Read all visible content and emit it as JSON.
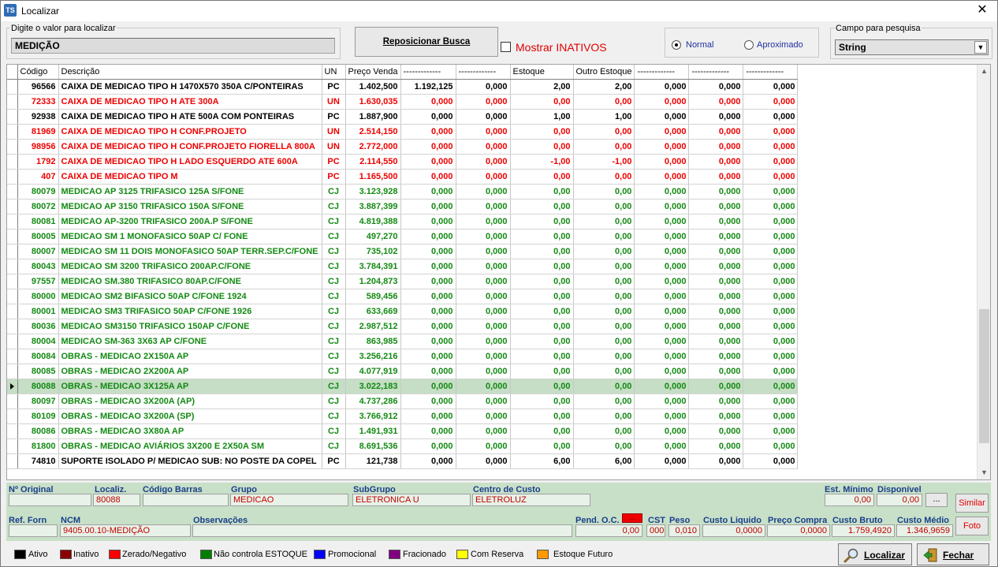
{
  "window": {
    "title": "Localizar",
    "icon_text": "TS"
  },
  "search": {
    "label": "Digite o valor para localizar",
    "value": "MEDIÇÃO",
    "reposition_button": "Reposicionar Busca",
    "show_inactive_label": "Mostrar INATIVOS",
    "show_inactive_checked": false,
    "mode_normal": "Normal",
    "mode_approx": "Aproximado",
    "mode_selected": "Normal",
    "field_label": "Campo para pesquisa",
    "field_value": "String"
  },
  "grid": {
    "columns": [
      "Código",
      "Descrição",
      "UN",
      "Preço Venda",
      "-------------",
      "-------------",
      "Estoque",
      "Outro Estoque",
      "-------------",
      "-------------",
      "-------------"
    ],
    "rows": [
      {
        "status": "black",
        "cells": [
          "96566",
          "CAIXA DE MEDICAO TIPO H 1470X570 350A C/PONTEIRAS",
          "PC",
          "1.402,500",
          "1.192,125",
          "0,000",
          "2,00",
          "2,00",
          "0,000",
          "0,000",
          "0,000"
        ]
      },
      {
        "status": "red",
        "cells": [
          "72333",
          "CAIXA DE MEDICAO TIPO H ATE 300A",
          "UN",
          "1.630,035",
          "0,000",
          "0,000",
          "0,00",
          "0,00",
          "0,000",
          "0,000",
          "0,000"
        ]
      },
      {
        "status": "black",
        "cells": [
          "92938",
          "CAIXA DE MEDICAO TIPO H ATE 500A COM PONTEIRAS",
          "PC",
          "1.887,900",
          "0,000",
          "0,000",
          "1,00",
          "1,00",
          "0,000",
          "0,000",
          "0,000"
        ]
      },
      {
        "status": "red",
        "cells": [
          "81969",
          "CAIXA DE MEDICAO TIPO H CONF.PROJETO",
          "UN",
          "2.514,150",
          "0,000",
          "0,000",
          "0,00",
          "0,00",
          "0,000",
          "0,000",
          "0,000"
        ]
      },
      {
        "status": "red",
        "cells": [
          "98956",
          "CAIXA DE MEDICAO TIPO H CONF.PROJETO FIORELLA 800A",
          "UN",
          "2.772,000",
          "0,000",
          "0,000",
          "0,00",
          "0,00",
          "0,000",
          "0,000",
          "0,000"
        ]
      },
      {
        "status": "red",
        "cells": [
          "1792",
          "CAIXA DE MEDICAO TIPO H LADO ESQUERDO   ATE 600A",
          "PC",
          "2.114,550",
          "0,000",
          "0,000",
          "-1,00",
          "-1,00",
          "0,000",
          "0,000",
          "0,000"
        ]
      },
      {
        "status": "red",
        "cells": [
          "407",
          "CAIXA DE MEDICAO TIPO M",
          "PC",
          "1.165,500",
          "0,000",
          "0,000",
          "0,00",
          "0,00",
          "0,000",
          "0,000",
          "0,000"
        ]
      },
      {
        "status": "green",
        "cells": [
          "80079",
          "MEDICAO AP 3125 TRIFASICO 125A S/FONE",
          "CJ",
          "3.123,928",
          "0,000",
          "0,000",
          "0,00",
          "0,00",
          "0,000",
          "0,000",
          "0,000"
        ]
      },
      {
        "status": "green",
        "cells": [
          "80072",
          "MEDICAO AP 3150 TRIFASICO 150A S/FONE",
          "CJ",
          "3.887,399",
          "0,000",
          "0,000",
          "0,00",
          "0,00",
          "0,000",
          "0,000",
          "0,000"
        ]
      },
      {
        "status": "green",
        "cells": [
          "80081",
          "MEDICAO AP-3200 TRIFASICO 200A.P S/FONE",
          "CJ",
          "4.819,388",
          "0,000",
          "0,000",
          "0,00",
          "0,00",
          "0,000",
          "0,000",
          "0,000"
        ]
      },
      {
        "status": "green",
        "cells": [
          "80005",
          "MEDICAO SM 1 MONOFASICO 50AP C/ FONE",
          "CJ",
          "497,270",
          "0,000",
          "0,000",
          "0,00",
          "0,00",
          "0,000",
          "0,000",
          "0,000"
        ]
      },
      {
        "status": "green",
        "cells": [
          "80007",
          "MEDICAO SM 11 DOIS MONOFASICO 50AP TERR.SEP.C/FONE",
          "CJ",
          "735,102",
          "0,000",
          "0,000",
          "0,00",
          "0,00",
          "0,000",
          "0,000",
          "0,000"
        ]
      },
      {
        "status": "green",
        "cells": [
          "80043",
          "MEDICAO SM 3200 TRIFASICO 200AP.C/FONE",
          "CJ",
          "3.784,391",
          "0,000",
          "0,000",
          "0,00",
          "0,00",
          "0,000",
          "0,000",
          "0,000"
        ]
      },
      {
        "status": "green",
        "cells": [
          "97557",
          "MEDICAO SM.380 TRIFASICO 80AP.C/FONE",
          "CJ",
          "1.204,873",
          "0,000",
          "0,000",
          "0,00",
          "0,00",
          "0,000",
          "0,000",
          "0,000"
        ]
      },
      {
        "status": "green",
        "cells": [
          "80000",
          "MEDICAO SM2 BIFASICO 50AP C/FONE 1924",
          "CJ",
          "589,456",
          "0,000",
          "0,000",
          "0,00",
          "0,00",
          "0,000",
          "0,000",
          "0,000"
        ]
      },
      {
        "status": "green",
        "cells": [
          "80001",
          "MEDICAO SM3 TRIFASICO 50AP C/FONE 1926",
          "CJ",
          "633,669",
          "0,000",
          "0,000",
          "0,00",
          "0,00",
          "0,000",
          "0,000",
          "0,000"
        ]
      },
      {
        "status": "green",
        "cells": [
          "80036",
          "MEDICAO SM3150 TRIFASICO 150AP C/FONE",
          "CJ",
          "2.987,512",
          "0,000",
          "0,000",
          "0,00",
          "0,00",
          "0,000",
          "0,000",
          "0,000"
        ]
      },
      {
        "status": "green",
        "cells": [
          "80004",
          "MEDICAO SM-363 3X63 AP C/FONE",
          "CJ",
          "863,985",
          "0,000",
          "0,000",
          "0,00",
          "0,00",
          "0,000",
          "0,000",
          "0,000"
        ]
      },
      {
        "status": "green",
        "cells": [
          "80084",
          "OBRAS - MEDICAO 2X150A AP",
          "CJ",
          "3.256,216",
          "0,000",
          "0,000",
          "0,00",
          "0,00",
          "0,000",
          "0,000",
          "0,000"
        ]
      },
      {
        "status": "green",
        "cells": [
          "80085",
          "OBRAS - MEDICAO 2X200A AP",
          "CJ",
          "4.077,919",
          "0,000",
          "0,000",
          "0,00",
          "0,00",
          "0,000",
          "0,000",
          "0,000"
        ]
      },
      {
        "status": "green",
        "selected": true,
        "cells": [
          "80088",
          "OBRAS - MEDICAO 3X125A AP",
          "CJ",
          "3.022,183",
          "0,000",
          "0,000",
          "0,00",
          "0,00",
          "0,000",
          "0,000",
          "0,000"
        ]
      },
      {
        "status": "green",
        "cells": [
          "80097",
          "OBRAS - MEDICAO 3X200A (AP)",
          "CJ",
          "4.737,286",
          "0,000",
          "0,000",
          "0,00",
          "0,00",
          "0,000",
          "0,000",
          "0,000"
        ]
      },
      {
        "status": "green",
        "cells": [
          "80109",
          "OBRAS - MEDICAO 3X200A (SP)",
          "CJ",
          "3.766,912",
          "0,000",
          "0,000",
          "0,00",
          "0,00",
          "0,000",
          "0,000",
          "0,000"
        ]
      },
      {
        "status": "green",
        "cells": [
          "80086",
          "OBRAS - MEDICAO 3X80A AP",
          "CJ",
          "1.491,931",
          "0,000",
          "0,000",
          "0,00",
          "0,00",
          "0,000",
          "0,000",
          "0,000"
        ]
      },
      {
        "status": "green",
        "cells": [
          "81800",
          "OBRAS - MEDICAO AVIÁRIOS 3X200 E 2X50A SM",
          "CJ",
          "8.691,536",
          "0,000",
          "0,000",
          "0,00",
          "0,00",
          "0,000",
          "0,000",
          "0,000"
        ]
      },
      {
        "status": "black",
        "cells": [
          "74810",
          "SUPORTE ISOLADO P/ MEDICAO SUB: NO POSTE DA COPEL",
          "PC",
          "121,738",
          "0,000",
          "0,000",
          "6,00",
          "6,00",
          "0,000",
          "0,000",
          "0,000"
        ]
      }
    ]
  },
  "detail": {
    "n_original_label": "Nº Original",
    "n_original": "",
    "localiz_label": "Localiz.",
    "localiz": "80088",
    "codigo_barras_label": "Código Barras",
    "codigo_barras": "",
    "grupo_label": "Grupo",
    "grupo": "MEDICAO",
    "subgrupo_label": "SubGrupo",
    "subgrupo": "ELETRONICA U",
    "centro_custo_label": "Centro de Custo",
    "centro_custo": "ELETROLUZ",
    "est_minimo_label": "Est. Mínimo",
    "est_minimo": "0,00",
    "disponivel_label": "Disponível",
    "disponivel": "0,00",
    "ellipsis": "...",
    "similar": "Similar",
    "ref_forn_label": "Ref. Forn",
    "ref_forn": "",
    "ncm_label": "NCM",
    "ncm": "9405.00.10-MEDIÇÃO",
    "observacoes_label": "Observações",
    "observacoes": "",
    "pend_oc_label": "Pend. O.C.",
    "pend_oc": "0,00",
    "pend_oc_btn": "...",
    "cst_label": "CST",
    "cst": "000",
    "peso_label": "Peso",
    "peso": "0,010",
    "custo_liquido_label": "Custo Liquido",
    "custo_liquido": "0,0000",
    "preco_compra_label": "Preço Compra",
    "preco_compra": "0,0000",
    "custo_bruto_label": "Custo Bruto",
    "custo_bruto": "1.759,4920",
    "custo_medio_label": "Custo Médio",
    "custo_medio": "1.346,9659",
    "foto": "Foto"
  },
  "legend": [
    {
      "label": "Ativo",
      "color": "#000000"
    },
    {
      "label": "Inativo",
      "color": "#8b0000"
    },
    {
      "label": "Zerado/Negativo",
      "color": "#ff0000"
    },
    {
      "label": "Não controla ESTOQUE",
      "color": "#008000"
    },
    {
      "label": "Promocional",
      "color": "#0000ff"
    },
    {
      "label": "Fracionado",
      "color": "#800080"
    },
    {
      "label": "Com Reserva",
      "color": "#ffff00"
    },
    {
      "label": "Estoque Futuro",
      "color": "#ff9900"
    }
  ],
  "buttons": {
    "localizar": "Localizar",
    "fechar": "Fechar"
  },
  "colors": {
    "status_black": "#000000",
    "status_red": "#ee0000",
    "status_green": "#138a13",
    "selected_row": "#c5dec5",
    "detail_panel": "#c8e0c8"
  }
}
